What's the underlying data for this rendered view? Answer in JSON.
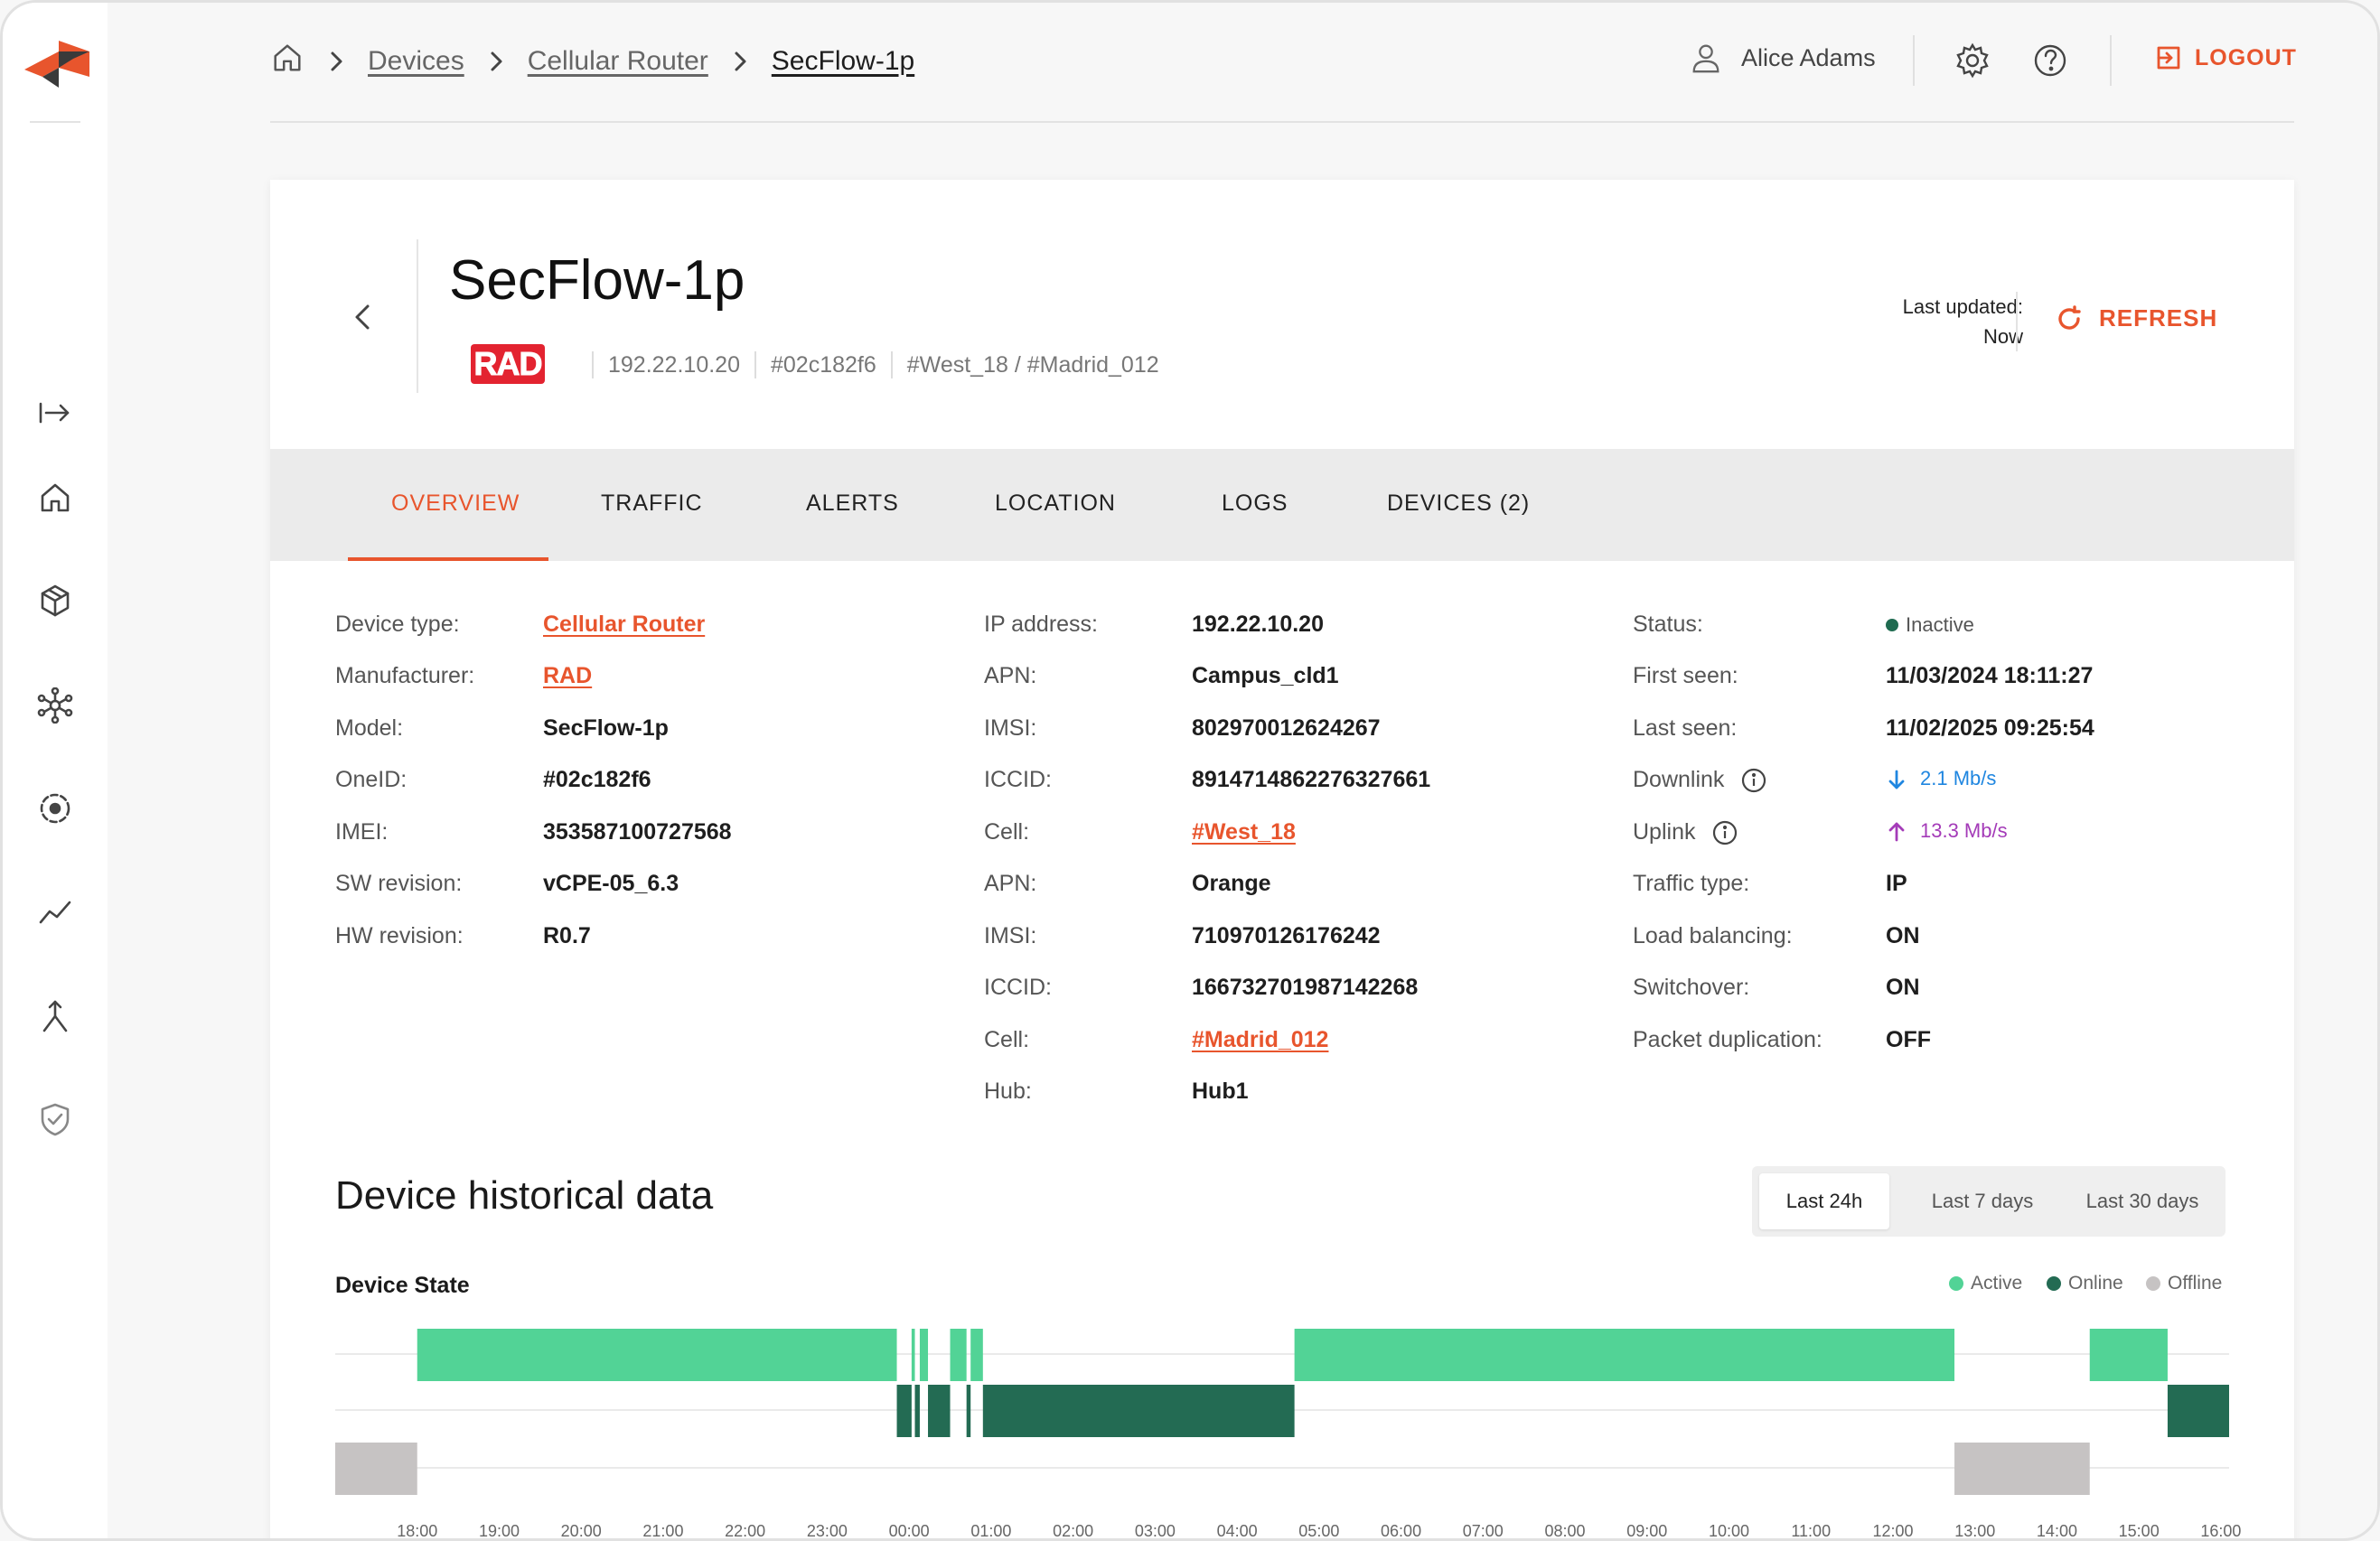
{
  "nav": {
    "icons": [
      "expand-icon",
      "home-icon",
      "cube-icon",
      "network-icon",
      "target-icon",
      "trend-icon",
      "merge-icon",
      "shield-icon"
    ]
  },
  "breadcrumb": {
    "items": [
      "Devices",
      "Cellular Router",
      "SecFlow-1p"
    ]
  },
  "user": {
    "name": "Alice Adams"
  },
  "logout_label": "LOGOUT",
  "device": {
    "title": "SecFlow-1p",
    "brand_logo": "RAD",
    "ip": "192.22.10.20",
    "id": "#02c182f6",
    "cells": "#West_18 / #Madrid_012",
    "last_updated_label": "Last updated:",
    "last_updated_value": "Now",
    "refresh_label": "REFRESH"
  },
  "tabs": [
    "OVERVIEW",
    "TRAFFIC",
    "ALERTS",
    "LOCATION",
    "LOGS",
    "DEVICES (2)"
  ],
  "details": {
    "col1": [
      {
        "label": "Device type:",
        "value": "Cellular Router",
        "link": true
      },
      {
        "label": "Manufacturer:",
        "value": "RAD",
        "link": true
      },
      {
        "label": "Model:",
        "value": "SecFlow-1p"
      },
      {
        "label": "OneID:",
        "value": "#02c182f6"
      },
      {
        "label": "IMEI:",
        "value": "353587100727568"
      },
      {
        "label": "SW revision:",
        "value": "vCPE-05_6.3"
      },
      {
        "label": "HW revision:",
        "value": "R0.7"
      }
    ],
    "col2": [
      {
        "label": "IP address:",
        "value": "192.22.10.20"
      },
      {
        "label": "APN:",
        "value": "Campus_cld1"
      },
      {
        "label": "IMSI:",
        "value": "802970012624267"
      },
      {
        "label": "ICCID:",
        "value": "8914714862276327661"
      },
      {
        "label": "Cell:",
        "value": "#West_18",
        "link": true
      },
      {
        "label": "APN:",
        "value": "Orange"
      },
      {
        "label": "IMSI:",
        "value": "710970126176242"
      },
      {
        "label": "ICCID:",
        "value": "166732701987142268"
      },
      {
        "label": "Cell:",
        "value": "#Madrid_012",
        "link": true
      },
      {
        "label": "Hub:",
        "value": "Hub1"
      }
    ],
    "col3": [
      {
        "label": "Status:",
        "value": "Inactive"
      },
      {
        "label": "First seen:",
        "value": "11/03/2024 18:11:27"
      },
      {
        "label": "Last seen:",
        "value": "11/02/2025 09:25:54"
      },
      {
        "label": "Downlink",
        "value": "2.1 Mb/s"
      },
      {
        "label": "Uplink",
        "value": "13.3 Mb/s"
      },
      {
        "label": "Traffic type:",
        "value": "IP"
      },
      {
        "label": "Load balancing:",
        "value": "ON"
      },
      {
        "label": "Switchover:",
        "value": "ON"
      },
      {
        "label": "Packet duplication:",
        "value": "OFF"
      }
    ]
  },
  "history": {
    "title": "Device historical data",
    "ranges": [
      "Last 24h",
      "Last 7 days",
      "Last 30 days"
    ],
    "selected_range": "Last 24h",
    "chart_title": "Device State"
  },
  "colors": {
    "accent": "#e8552d",
    "active": "#52d396",
    "online": "#236b53",
    "offline": "#c6c3c3"
  },
  "chart_data": {
    "type": "timeline",
    "title": "Device State",
    "legend": [
      "Active",
      "Online",
      "Offline"
    ],
    "legend_position": "top-right",
    "x_ticks": [
      "18:00",
      "19:00",
      "20:00",
      "21:00",
      "22:00",
      "23:00",
      "00:00",
      "01:00",
      "02:00",
      "03:00",
      "04:00",
      "05:00",
      "06:00",
      "07:00",
      "08:00",
      "09:00",
      "10:00",
      "11:00",
      "12:00",
      "13:00",
      "14:00",
      "15:00",
      "16:00"
    ],
    "x_range_hours": [
      17.0,
      40.1
    ],
    "segments": [
      {
        "state": "Offline",
        "start": 17.0,
        "end": 18.0
      },
      {
        "state": "Active",
        "start": 18.0,
        "end": 23.85
      },
      {
        "state": "Online",
        "start": 23.85,
        "end": 24.03
      },
      {
        "state": "Active",
        "start": 24.03,
        "end": 24.07
      },
      {
        "state": "Online",
        "start": 24.07,
        "end": 24.13
      },
      {
        "state": "Active",
        "start": 24.13,
        "end": 24.23
      },
      {
        "state": "Online",
        "start": 24.23,
        "end": 24.5
      },
      {
        "state": "Active",
        "start": 24.5,
        "end": 24.7
      },
      {
        "state": "Online",
        "start": 24.7,
        "end": 24.75
      },
      {
        "state": "Active",
        "start": 24.75,
        "end": 24.9
      },
      {
        "state": "Online",
        "start": 24.9,
        "end": 28.7
      },
      {
        "state": "Active",
        "start": 28.7,
        "end": 36.75
      },
      {
        "state": "Offline",
        "start": 36.75,
        "end": 38.4
      },
      {
        "state": "Active",
        "start": 38.4,
        "end": 39.35
      },
      {
        "state": "Online",
        "start": 39.35,
        "end": 40.6
      }
    ]
  }
}
